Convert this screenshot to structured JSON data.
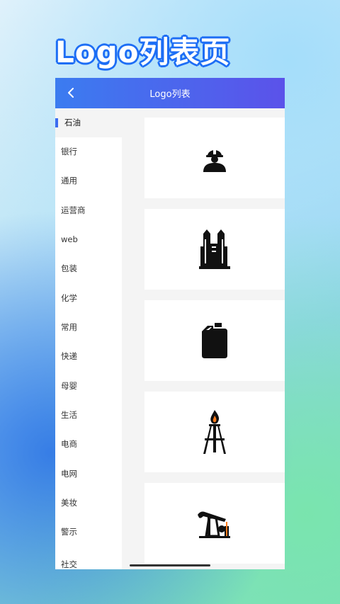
{
  "hero": {
    "title": "Logo列表页"
  },
  "navbar": {
    "title": "Logo列表",
    "back_icon": "chevron-left-icon"
  },
  "sidebar": {
    "items": [
      {
        "label": "石油",
        "active": true
      },
      {
        "label": "银行"
      },
      {
        "label": "通用"
      },
      {
        "label": "运营商"
      },
      {
        "label": "web"
      },
      {
        "label": "包装"
      },
      {
        "label": "化学"
      },
      {
        "label": "常用"
      },
      {
        "label": "快递"
      },
      {
        "label": "母婴"
      },
      {
        "label": "生活"
      },
      {
        "label": "电商"
      },
      {
        "label": "电网"
      },
      {
        "label": "美妆"
      },
      {
        "label": "警示"
      },
      {
        "label": "社交"
      }
    ]
  },
  "content": {
    "cards": [
      {
        "icon": "oil-worker-icon"
      },
      {
        "icon": "refinery-icon"
      },
      {
        "icon": "jerrycan-icon"
      },
      {
        "icon": "oil-derrick-flame-icon"
      },
      {
        "icon": "pumpjack-icon"
      }
    ]
  },
  "colors": {
    "accent": "#3b6cf0",
    "navbar_start": "#3b7cf0",
    "navbar_end": "#5b52ea",
    "hero_outline": "#1f6ff5"
  }
}
